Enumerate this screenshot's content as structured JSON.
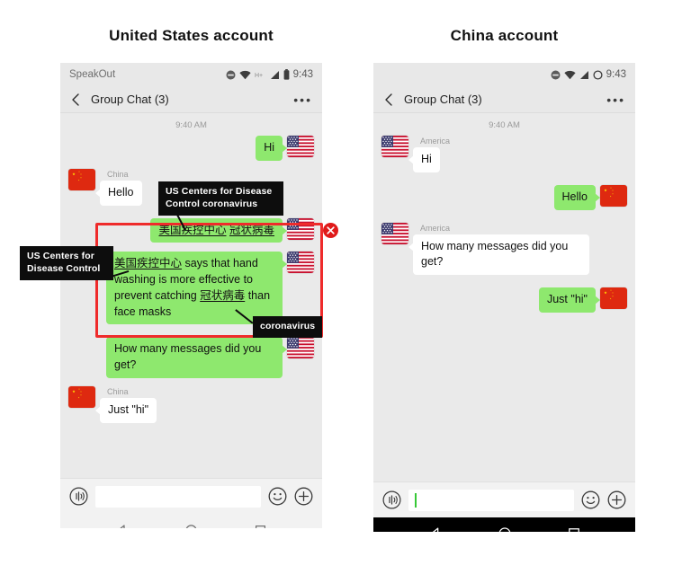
{
  "headings": {
    "us": "United States account",
    "cn": "China account"
  },
  "us_phone": {
    "status": {
      "app_name": "SpeakOut",
      "time": "9:43",
      "icons": [
        "do-not-disturb-icon",
        "wifi-icon",
        "hplus-network-icon",
        "signal-icon",
        "battery-icon"
      ]
    },
    "appbar": {
      "back": "back-chevron-icon",
      "title": "Group Chat (3)",
      "overflow": "•••"
    },
    "daystamp": "9:40 AM",
    "messages": [
      {
        "side": "out",
        "flag": "us",
        "sender": "",
        "text": "Hi"
      },
      {
        "side": "in",
        "flag": "cn",
        "sender": "China",
        "text": "Hello"
      },
      {
        "side": "out",
        "flag": "us",
        "sender": "",
        "text": "美国疾控中心 冠状病毒"
      },
      {
        "side": "out",
        "flag": "us",
        "sender": "",
        "text": "美国疾控中心 says that hand washing is more effective to prevent catching 冠状病毒 than face masks"
      },
      {
        "side": "out",
        "flag": "us",
        "sender": "",
        "text": "How many messages did you get?"
      },
      {
        "side": "in",
        "flag": "cn",
        "sender": "China",
        "text": "Just \"hi\""
      }
    ],
    "input": {
      "voice_icon": "voice-record-icon",
      "value": "",
      "emoji_icon": "emoji-smiley-icon",
      "plus_icon": "add-plus-icon"
    },
    "nav": {
      "back": "nav-back-icon",
      "home": "nav-home-icon",
      "recents": "nav-recents-icon"
    }
  },
  "cn_phone": {
    "status": {
      "app_name": "",
      "time": "9:43",
      "icons": [
        "do-not-disturb-icon",
        "wifi-icon",
        "signal-icon",
        "circle-icon"
      ]
    },
    "appbar": {
      "back": "back-chevron-icon",
      "title": "Group Chat (3)",
      "overflow": "•••"
    },
    "daystamp": "9:40 AM",
    "messages": [
      {
        "side": "in",
        "flag": "us",
        "sender": "America",
        "text": "Hi"
      },
      {
        "side": "out",
        "flag": "cn",
        "sender": "",
        "text": "Hello"
      },
      {
        "side": "in",
        "flag": "us",
        "sender": "America",
        "text": "How many messages did you get?"
      },
      {
        "side": "out",
        "flag": "cn",
        "sender": "",
        "text": "Just \"hi\""
      }
    ],
    "input": {
      "voice_icon": "voice-record-icon",
      "value": "",
      "emoji_icon": "emoji-smiley-icon",
      "plus_icon": "add-plus-icon"
    },
    "nav": {
      "back": "nav-back-icon",
      "home": "nav-home-icon",
      "recents": "nav-recents-icon"
    }
  },
  "annotations": {
    "callout_top": "US Centers for Disease Control coronavirus",
    "callout_left": "US Centers for Disease Control",
    "callout_bottom": "coronavirus",
    "blocked_icon": "blocked-x-icon",
    "highlight_color": "#ef2b2b",
    "callout_bg": "#0d0d0d"
  }
}
